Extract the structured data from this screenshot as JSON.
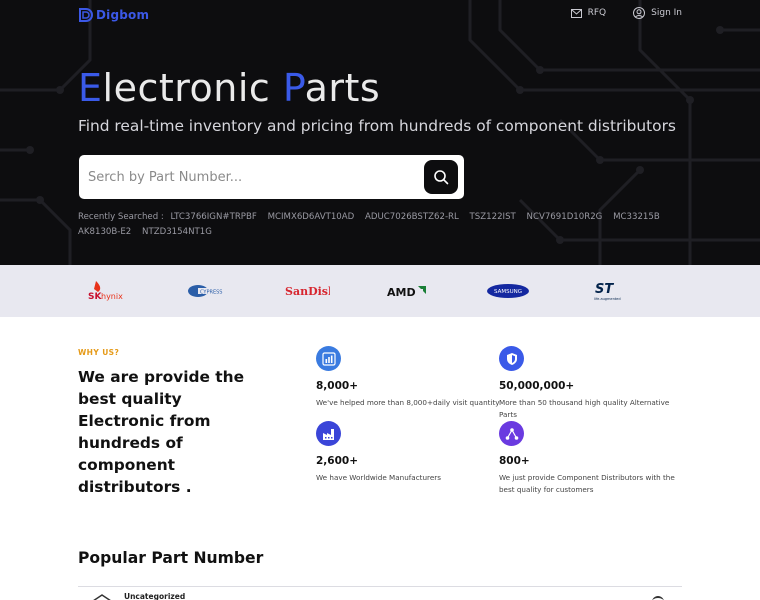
{
  "header": {
    "brand": "Digbom",
    "nav": [
      {
        "label": "RFQ",
        "icon": "mail-icon"
      },
      {
        "label": "Sign In",
        "icon": "user-icon"
      }
    ]
  },
  "hero": {
    "title_part1_initial": "E",
    "title_part1_rest": "lectronic ",
    "title_part2_initial": "P",
    "title_part2_rest": "arts",
    "subtitle": "Find real-time inventory and pricing from hundreds of component distributors",
    "search_placeholder": "Serch by Part Number...",
    "recent_label": "Recently Searched :",
    "recent": [
      "LTC3766IGN#TRPBF",
      "MCIMX6D6AVT10AD",
      "ADUC7026BSTZ62-RL",
      "TSZ122IST",
      "NCV7691D10R2G",
      "MC33215B",
      "AK8130B-E2",
      "NTZD3154NT1G"
    ]
  },
  "brands": [
    {
      "name": "SK hynix",
      "icon": "sk-hynix-logo"
    },
    {
      "name": "Cypress",
      "icon": "cypress-logo"
    },
    {
      "name": "SanDisk",
      "icon": "sandisk-logo"
    },
    {
      "name": "AMD",
      "icon": "amd-logo"
    },
    {
      "name": "SAMSUNG",
      "icon": "samsung-logo"
    },
    {
      "name": "ST",
      "icon": "st-logo"
    }
  ],
  "why": {
    "label": "WHY US?",
    "title": "We are provide the best quality Electronic from hundreds of component distributors .",
    "stats": [
      {
        "value": "8,000+",
        "desc": "We've helped more than 8,000+daily visit quantity",
        "icon": "chart-icon"
      },
      {
        "value": "50,000,000+",
        "desc": "More than 50 thousand high quality Alternative Parts",
        "icon": "shield-icon"
      },
      {
        "value": "2,600+",
        "desc": "We have Worldwide Manufacturers",
        "icon": "factory-icon"
      },
      {
        "value": "800+",
        "desc": "We just provide Component Distributors with the best quality for customers",
        "icon": "network-icon"
      }
    ]
  },
  "popular": {
    "title": "Popular Part Number",
    "first_category": "Uncategorized"
  },
  "colors": {
    "accent": "#3a5ae8",
    "dark": "#0d0d0f",
    "orange": "#e59a18",
    "brand_strip": "#e8e8f0"
  }
}
